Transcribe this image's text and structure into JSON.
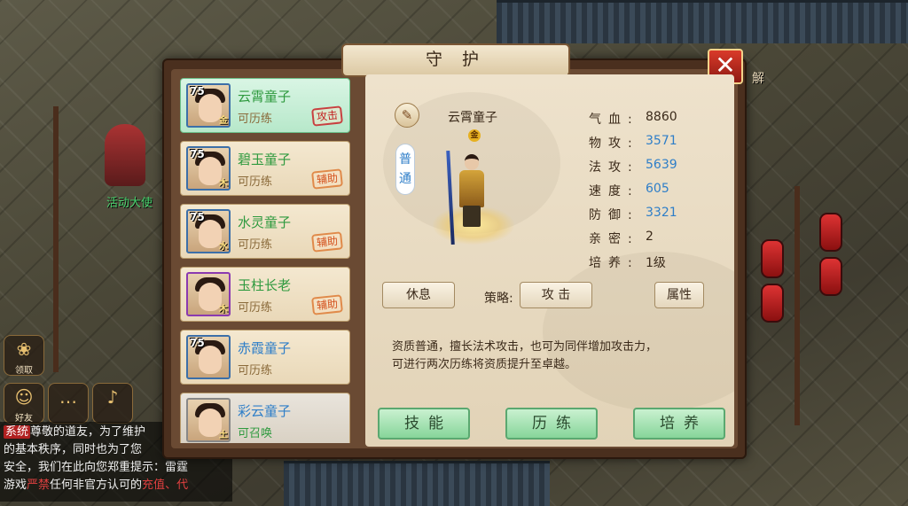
{
  "dialog": {
    "title": "守 护",
    "close_icon": "close-x-icon"
  },
  "guardians": [
    {
      "level": "75",
      "name": "云霄童子",
      "element": "金",
      "status": "可历练",
      "role": "攻击",
      "selected": true,
      "portrait_frame": "blue"
    },
    {
      "level": "75",
      "name": "碧玉童子",
      "element": "木",
      "status": "可历练",
      "role": "辅助",
      "selected": false,
      "portrait_frame": "blue"
    },
    {
      "level": "75",
      "name": "水灵童子",
      "element": "水",
      "status": "可历练",
      "role": "辅助",
      "selected": false,
      "portrait_frame": "blue"
    },
    {
      "level": "75",
      "name": "玉柱长老",
      "element": "木",
      "status": "可历练",
      "role": "辅助",
      "selected": false,
      "portrait_frame": "purple"
    },
    {
      "level": "75",
      "name": "赤霞童子",
      "element": "",
      "status": "可历练",
      "role": "",
      "selected": false,
      "portrait_frame": "blue"
    },
    {
      "level": "",
      "name": "彩云童子",
      "element": "土",
      "status": "可召唤",
      "role": "",
      "selected": false,
      "portrait_frame": "grey"
    }
  ],
  "detail": {
    "hero_name": "云霄童子",
    "element_badge": "金",
    "quality": "普通",
    "stats": [
      {
        "label": "气血:",
        "value": "8860",
        "color": "#3b2a1a"
      },
      {
        "label": "物攻:",
        "value": "3571",
        "color": "#2e7ec8"
      },
      {
        "label": "法攻:",
        "value": "5639",
        "color": "#2e7ec8"
      },
      {
        "label": "速度:",
        "value": "605",
        "color": "#2e7ec8"
      },
      {
        "label": "防御:",
        "value": "3321",
        "color": "#2e7ec8"
      },
      {
        "label": "亲密:",
        "value": "2",
        "color": "#3b2a1a"
      },
      {
        "label": "培养:",
        "value": "1级",
        "color": "#3b2a1a"
      }
    ],
    "rest_button": "休息",
    "strategy_label": "策略:",
    "strategy_value": "攻 击",
    "attributes_button": "属性",
    "description_line1": "资质普通，擅长法术攻击，也可为同伴增加攻击力，",
    "description_line2": "可进行两次历练将资质提升至卓越。",
    "skills_button": "技能",
    "train_button": "历练",
    "cultivate_button": "培养"
  },
  "scene": {
    "npc_label": "活动大使",
    "right_hint": "解",
    "side_buttons": {
      "claim": "领取",
      "friends": "好友"
    },
    "chat": {
      "tag": "系统",
      "line1": "尊敬的道友，为了维护",
      "line2": "的基本秩序，同时也为了您",
      "line3": "安全，我们在此向您郑重提示：雷霆",
      "line4_a": "游戏",
      "line4_b": "严禁",
      "line4_c": "任何非官方认可的",
      "line4_d": "充值",
      "line4_e": "、代"
    }
  }
}
